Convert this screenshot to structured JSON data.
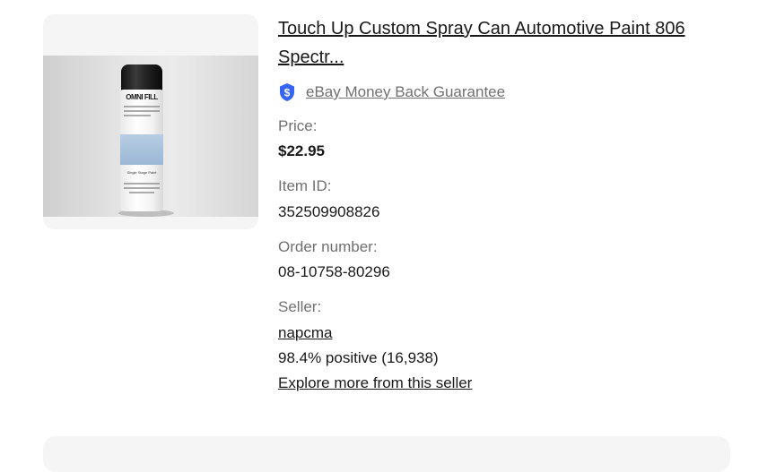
{
  "item": {
    "title": "Touch Up Custom Spray Can Automotive Paint 806 Spectr...",
    "guarantee_label": "eBay Money Back Guarantee",
    "guarantee_icon": "shield-dollar-icon",
    "price_label": "Price:",
    "price_value": "$22.95",
    "item_id_label": "Item ID:",
    "item_id_value": "352509908826",
    "order_label": "Order number:",
    "order_value": "08-10758-80296",
    "seller_label": "Seller:",
    "seller_name": "napcma",
    "seller_feedback": "98.4% positive (16,938)",
    "explore_link": "Explore more from this seller"
  },
  "image": {
    "brand_text": "OMNI FILL",
    "label_text": "Single Stage Paint"
  },
  "colors": {
    "shield": "#3665f3",
    "text": "#191919",
    "muted": "#707070"
  }
}
